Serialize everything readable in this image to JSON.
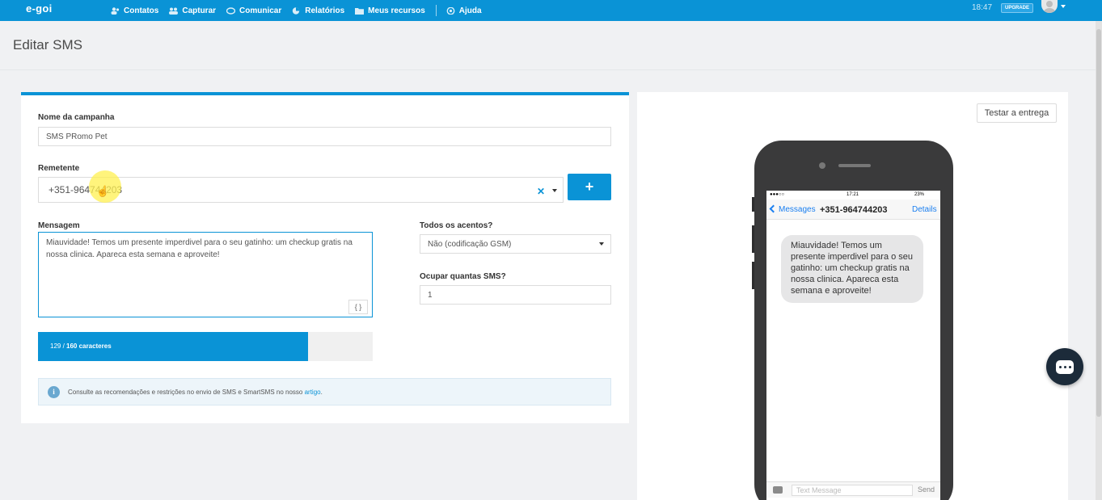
{
  "header": {
    "logo": "e-goi",
    "nav": [
      {
        "label": "Contatos",
        "icon": "contacts-icon"
      },
      {
        "label": "Capturar",
        "icon": "capture-icon"
      },
      {
        "label": "Comunicar",
        "icon": "communicate-icon"
      },
      {
        "label": "Relatórios",
        "icon": "reports-icon"
      },
      {
        "label": "Meus recursos",
        "icon": "folder-icon"
      }
    ],
    "help_label": "Ajuda",
    "time": "18:47",
    "upgrade_label": "UPGRADE"
  },
  "page": {
    "title": "Editar SMS"
  },
  "form": {
    "campaign_label": "Nome da campanha",
    "campaign_value": "SMS PRomo Pet",
    "sender_label": "Remetente",
    "sender_value": "+351-964744203",
    "add_label": "+",
    "message_label": "Mensagem",
    "message_value": "Miauvidade! Temos um presente imperdivel para o seu gatinho: um checkup gratis na nossa clinica. Apareca esta semana e aproveite!",
    "var_label": "{ }",
    "accents_label": "Todos os acentos?",
    "accents_value": "Não (codificação GSM)",
    "sms_count_label": "Ocupar quantas SMS?",
    "sms_count_value": "1",
    "counter_current": "129",
    "counter_sep": " / ",
    "counter_max": "160 caracteres",
    "counter_fraction": 0.80625,
    "info_text": "Consulte as recomendações e restrições no envio de SMS e SmartSMS no nosso ",
    "info_link": "artigo",
    "info_end": "."
  },
  "preview": {
    "test_label": "Testar a entrega",
    "status_signal": "●●●○○",
    "status_time": "17:21",
    "status_battery": "23%",
    "back_label": "Messages",
    "contact": "+351-964744203",
    "details_label": "Details",
    "bubble": "Miauvidade! Temos um presente imperdivel para o seu gatinho: um checkup gratis na nossa clinica. Apareca esta semana e aproveite!",
    "input_placeholder": "Text Message",
    "send_label": "Send"
  },
  "colors": {
    "brand": "#0a93d6",
    "chat_fab": "#1c2b3a"
  }
}
